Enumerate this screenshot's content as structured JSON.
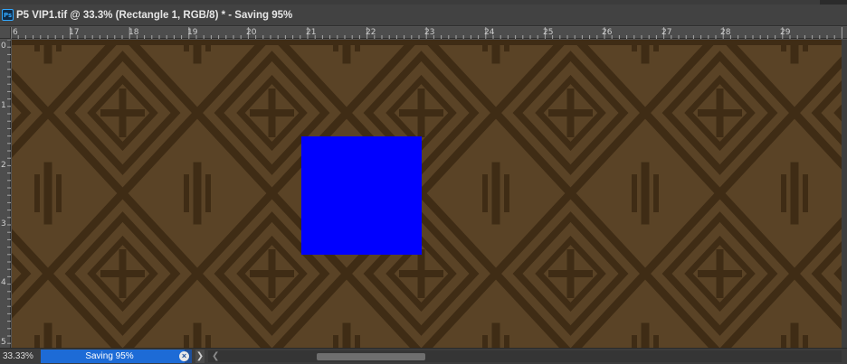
{
  "document": {
    "tab_title": "P5 VIP1.tif @ 33.3% (Rectangle 1, RGB/8) * - Saving 95%",
    "app_icon": "photoshop-icon",
    "app_icon_text": "Ps"
  },
  "ruler_horizontal": {
    "labels": [
      "6",
      "17",
      "18",
      "19",
      "20",
      "21",
      "22",
      "23",
      "24",
      "25",
      "26",
      "27",
      "28",
      "29"
    ]
  },
  "ruler_vertical": {
    "labels": [
      "0",
      "1",
      "2",
      "3",
      "4",
      "5"
    ]
  },
  "canvas": {
    "pattern_colors": {
      "base": "#5a4326",
      "dark": "#3f2c15"
    },
    "rectangle_layer": {
      "name": "Rectangle 1",
      "fill": "#0000ff"
    }
  },
  "status": {
    "zoom": "33.33%",
    "progress_label": "Saving 95%",
    "progress_percent": 95,
    "progress_color": "#1d6bd6",
    "cancel_icon": "close-circle-icon",
    "expand_icon": "chevron-right-icon",
    "scroll_left_icon": "chevron-left-icon"
  }
}
